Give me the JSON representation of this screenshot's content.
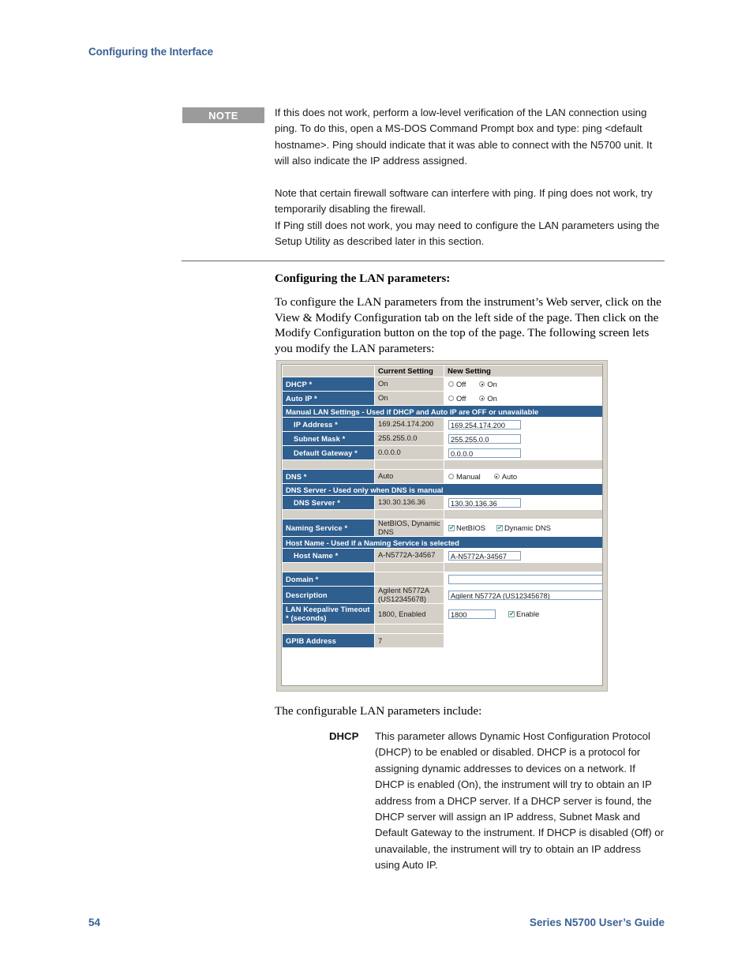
{
  "page": {
    "running_head": "Configuring the Interface",
    "folio": "54",
    "footer_right": "Series N5700 User’s Guide"
  },
  "note": {
    "tag": "NOTE",
    "paragraph1": "If this does not work, perform a low-level verification of the LAN connection using ping. To do this, open a MS-DOS Command Prompt box and type: ping <default hostname>. Ping should indicate that it was able to connect with the N5700 unit. It will also indicate the IP address assigned.",
    "paragraph2": "Note that certain firewall software can interfere with ping. If ping does not work, try temporarily disabling the firewall.",
    "paragraph3": "If Ping still does not work, you may need to configure the LAN parameters using the Setup Utility as described later in this section."
  },
  "section": {
    "heading": "Configuring the LAN parameters:",
    "intro": "To configure the LAN parameters from the instrument’s Web server, click on the View & Modify Configuration tab on the left side of the page. Then click on the Modify Configuration button on the top of the page. The following screen lets you modify the LAN parameters:",
    "after_figure": "The configurable LAN parameters include:"
  },
  "figure": {
    "columns": {
      "parameter": "",
      "current": "Current Setting",
      "new": "New Setting"
    },
    "rows": {
      "dhcp": {
        "label": "DHCP *",
        "current": "On",
        "options": [
          "Off",
          "On"
        ],
        "selected": "On"
      },
      "auto_ip": {
        "label": "Auto IP *",
        "current": "On",
        "options": [
          "Off",
          "On"
        ],
        "selected": "On"
      },
      "manual_band": "Manual LAN Settings - Used if DHCP and Auto IP are OFF or unavailable",
      "ip_address": {
        "label": "IP Address *",
        "current": "169.254.174.200",
        "new": "169.254.174.200"
      },
      "subnet_mask": {
        "label": "Subnet Mask *",
        "current": "255.255.0.0",
        "new": "255.255.0.0"
      },
      "default_gateway": {
        "label": "Default Gateway *",
        "current": "0.0.0.0",
        "new": "0.0.0.0"
      },
      "dns": {
        "label": "DNS *",
        "current": "Auto",
        "options": [
          "Manual",
          "Auto"
        ],
        "selected": "Auto"
      },
      "dns_band": "DNS Server - Used only when DNS is manual",
      "dns_server": {
        "label": "DNS Server *",
        "current": "130.30.136.36",
        "new": "130.30.136.36"
      },
      "naming_service": {
        "label": "Naming Service *",
        "current": "NetBIOS, Dynamic DNS",
        "checkbox1": "NetBIOS",
        "checkbox1_checked": true,
        "checkbox2": "Dynamic DNS",
        "checkbox2_checked": true
      },
      "host_band": "Host Name - Used if a Naming Service is selected",
      "host_name": {
        "label": "Host Name *",
        "current": "A-N5772A-34567",
        "new": "A-N5772A-34567"
      },
      "domain": {
        "label": "Domain *",
        "current": "",
        "new": ""
      },
      "description": {
        "label": "Description",
        "current": "Agilent N5772A (US12345678)",
        "new": "Agilent N5772A (US12345678)"
      },
      "lan_keepalive": {
        "label": "LAN Keepalive Timeout * (seconds)",
        "current": "1800, Enabled",
        "new": "1800",
        "enable_label": "Enable",
        "enable_checked": true
      },
      "gpib_address": {
        "label": "GPIB Address",
        "current": "7",
        "new": ""
      }
    }
  },
  "definition": {
    "term": "DHCP",
    "text": "This parameter allows Dynamic Host Configuration Protocol (DHCP) to be enabled or disabled.  DHCP is a protocol for assigning dynamic addresses to devices on a network. If DHCP is enabled (On), the instrument will try to obtain an IP address from a DHCP server. If a DHCP server is found, the DHCP server will assign an IP address, Subnet Mask and Default Gateway to the instrument. If DHCP is disabled (Off) or unavailable, the instrument will try to obtain an IP address using Auto IP."
  },
  "colors": {
    "brand_blue": "#3a6196",
    "table_header_blue": "#2f5f8f",
    "note_gray": "#9b9b9b",
    "cell_gray": "#d4d0c8",
    "check_green": "#1d9b3a"
  }
}
